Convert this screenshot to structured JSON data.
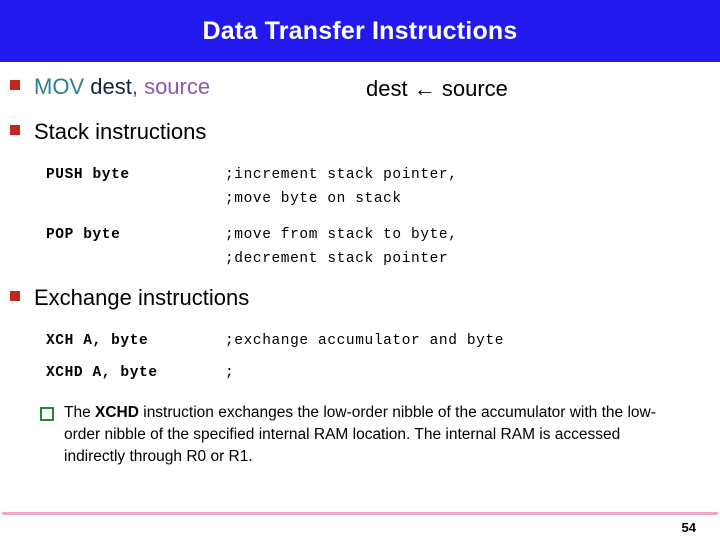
{
  "slide": {
    "title": "Data Transfer Instructions",
    "title_bar_color": "#2219ee",
    "bullet_color": "#c1271c",
    "sub_bullet_color": "#1f8a33",
    "footer_rule_color": "#eda8c8",
    "page_number": "54"
  },
  "mov_line": {
    "mnemonic": "MOV",
    "dest": " dest",
    "comma": ",",
    "source": " source",
    "expression_left": "dest",
    "expression_arrow": "←",
    "expression_right": "source",
    "mnemonic_color": "#2a7f93",
    "dest_color": "#16213e",
    "source_color": "#8d5ba6"
  },
  "sections": [
    {
      "heading": "Stack instructions",
      "entries": [
        {
          "mnemonic": "PUSH byte",
          "comments": [
            ";increment stack pointer,",
            ";move byte on stack"
          ]
        },
        {
          "mnemonic": "POP byte",
          "comments": [
            ";move from stack to byte,",
            ";decrement stack pointer"
          ]
        }
      ]
    },
    {
      "heading": "Exchange instructions",
      "entries": [
        {
          "mnemonic": "XCH A, byte",
          "comments": [
            ";exchange accumulator and byte"
          ]
        },
        {
          "mnemonic": "XCHD A, byte",
          "comments": [
            ";"
          ]
        }
      ]
    }
  ],
  "note": {
    "part1": "The ",
    "bold": "XCHD",
    "part2": " instruction exchanges the low-order nibble of the accumulator with the low-order nibble of the specified internal RAM location. The internal RAM is accessed indirectly through R0 or R1."
  }
}
